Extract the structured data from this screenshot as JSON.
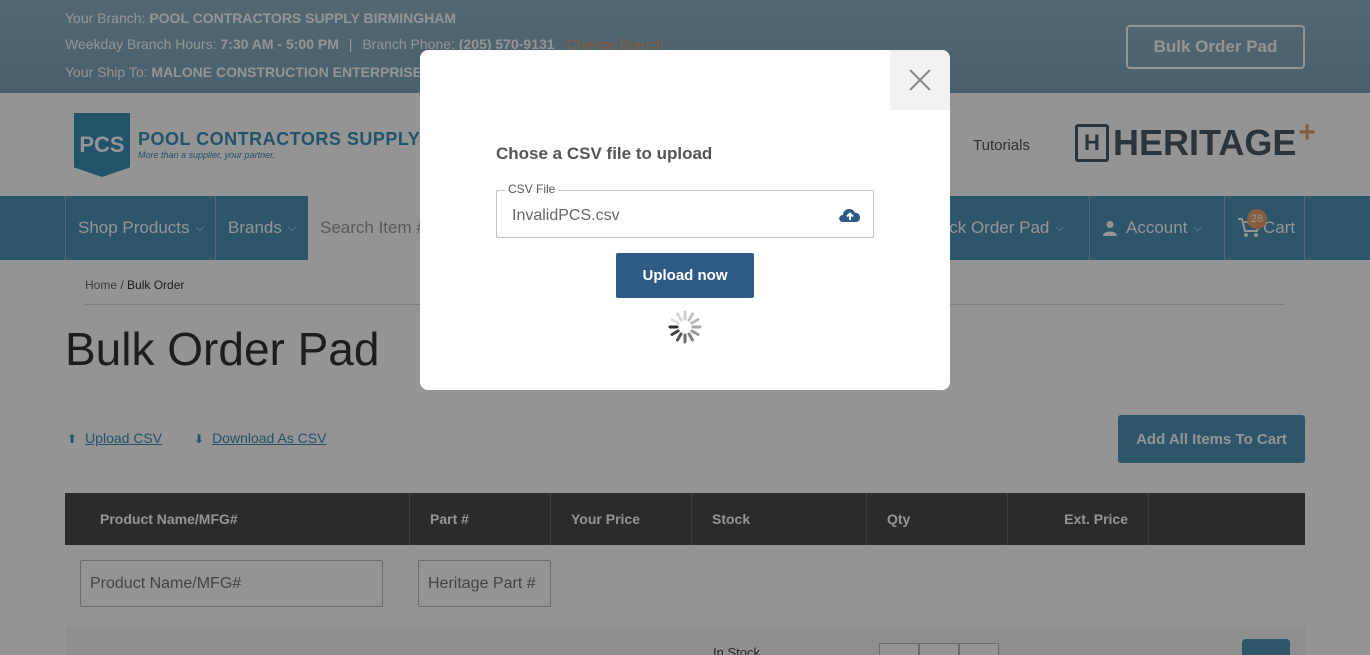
{
  "branch": {
    "branch_label": "Your Branch:",
    "branch_name": "POOL CONTRACTORS SUPPLY BIRMINGHAM",
    "hours_label": "Weekday Branch Hours:",
    "hours_value": "7:30 AM - 5:00 PM",
    "separator": "|",
    "phone_label": "Branch Phone:",
    "phone_value": "(205) 570-9131",
    "change_link": "Change Branch",
    "ship_label": "Your Ship To:",
    "ship_value": "MALONE CONSTRUCTION ENTERPRISE, S",
    "bulk_button": "Bulk Order Pad"
  },
  "header": {
    "logo_badge": "PCS",
    "logo_title": "POOL CONTRACTORS SUPPLY",
    "logo_tagline": "More than a supplier, your partner.",
    "partial_link": "s",
    "tutorials_link": "Tutorials",
    "heritage_box": "H",
    "heritage_text": "HERITAGE",
    "heritage_plus": "+"
  },
  "nav": {
    "shop_products": "Shop Products",
    "brands": "Brands",
    "search_placeholder": "Search Item #",
    "quick_order": "uick Order Pad",
    "account": "Account",
    "cart": "Cart",
    "cart_count": "28"
  },
  "breadcrumb": {
    "home": "Home",
    "separator": " / ",
    "current": "Bulk Order"
  },
  "page": {
    "title": "Bulk Order Pad",
    "upload_csv": "Upload CSV",
    "download_csv": "Download As CSV",
    "add_all": "Add All Items To Cart"
  },
  "table": {
    "headers": [
      "Product Name/MFG#",
      "Part #",
      "Your Price",
      "Stock",
      "Qty",
      "Ext. Price"
    ],
    "filter_product_placeholder": "Product Name/MFG#",
    "filter_part_placeholder": "Heritage Part #",
    "row_stock": "In Stock"
  },
  "modal": {
    "heading": "Chose a CSV file to upload",
    "field_label": "CSV File",
    "field_value": "InvalidPCS.csv",
    "upload_button": "Upload now"
  },
  "colors": {
    "accent": "#4f94b8",
    "modal_button": "#2e5b86",
    "orange": "#e8a26a"
  }
}
